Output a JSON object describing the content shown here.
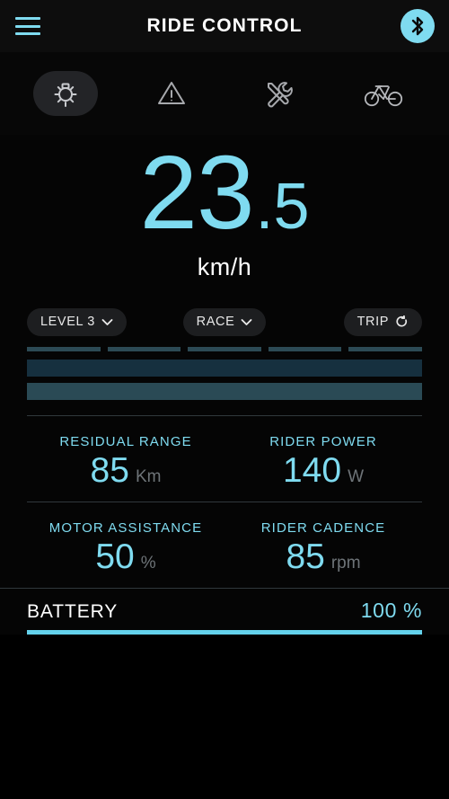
{
  "header": {
    "menu_icon": "hamburger-menu-icon",
    "title": "RIDE CONTROL",
    "bluetooth_icon": "bluetooth-icon",
    "accent_color": "#7fdbf0"
  },
  "icon_bar": {
    "items": [
      {
        "icon": "headlight-icon",
        "name": "headlight",
        "active": true
      },
      {
        "icon": "warning-triangle-icon",
        "name": "warning",
        "active": false
      },
      {
        "icon": "tools-icon",
        "name": "service",
        "active": false
      },
      {
        "icon": "bicycle-icon",
        "name": "bike",
        "active": false
      }
    ]
  },
  "speed": {
    "integer": "23",
    "decimal": ".5",
    "unit": "km/h",
    "color": "#7fdbf0"
  },
  "controls": {
    "assist_level": {
      "label": "LEVEL 3",
      "icon": "chevron-down-icon"
    },
    "ride_mode": {
      "label": "RACE",
      "icon": "chevron-down-icon"
    },
    "trip": {
      "label": "TRIP",
      "icon": "reset-refresh-icon"
    }
  },
  "gauges": {
    "segment_count": 5,
    "segment_color": "#2c4a55",
    "bars": [
      {
        "name": "motor-bar",
        "color": "#16303f",
        "fill_percent": 100
      },
      {
        "name": "rider-bar",
        "color": "#2a4a55",
        "fill_percent": 100
      }
    ]
  },
  "metrics": [
    {
      "label": "RESIDUAL RANGE",
      "value": "85",
      "unit": "Km",
      "name": "residual-range"
    },
    {
      "label": "RIDER POWER",
      "value": "140",
      "unit": "W",
      "name": "rider-power"
    },
    {
      "label": "MOTOR ASSISTANCE",
      "value": "50",
      "unit": "%",
      "name": "motor-assistance"
    },
    {
      "label": "RIDER CADENCE",
      "value": "85",
      "unit": "rpm",
      "name": "rider-cadence"
    }
  ],
  "battery": {
    "label": "BATTERY",
    "percent_text": "100 %",
    "fill_percent": 100,
    "fill_color": "#64d2ec"
  }
}
